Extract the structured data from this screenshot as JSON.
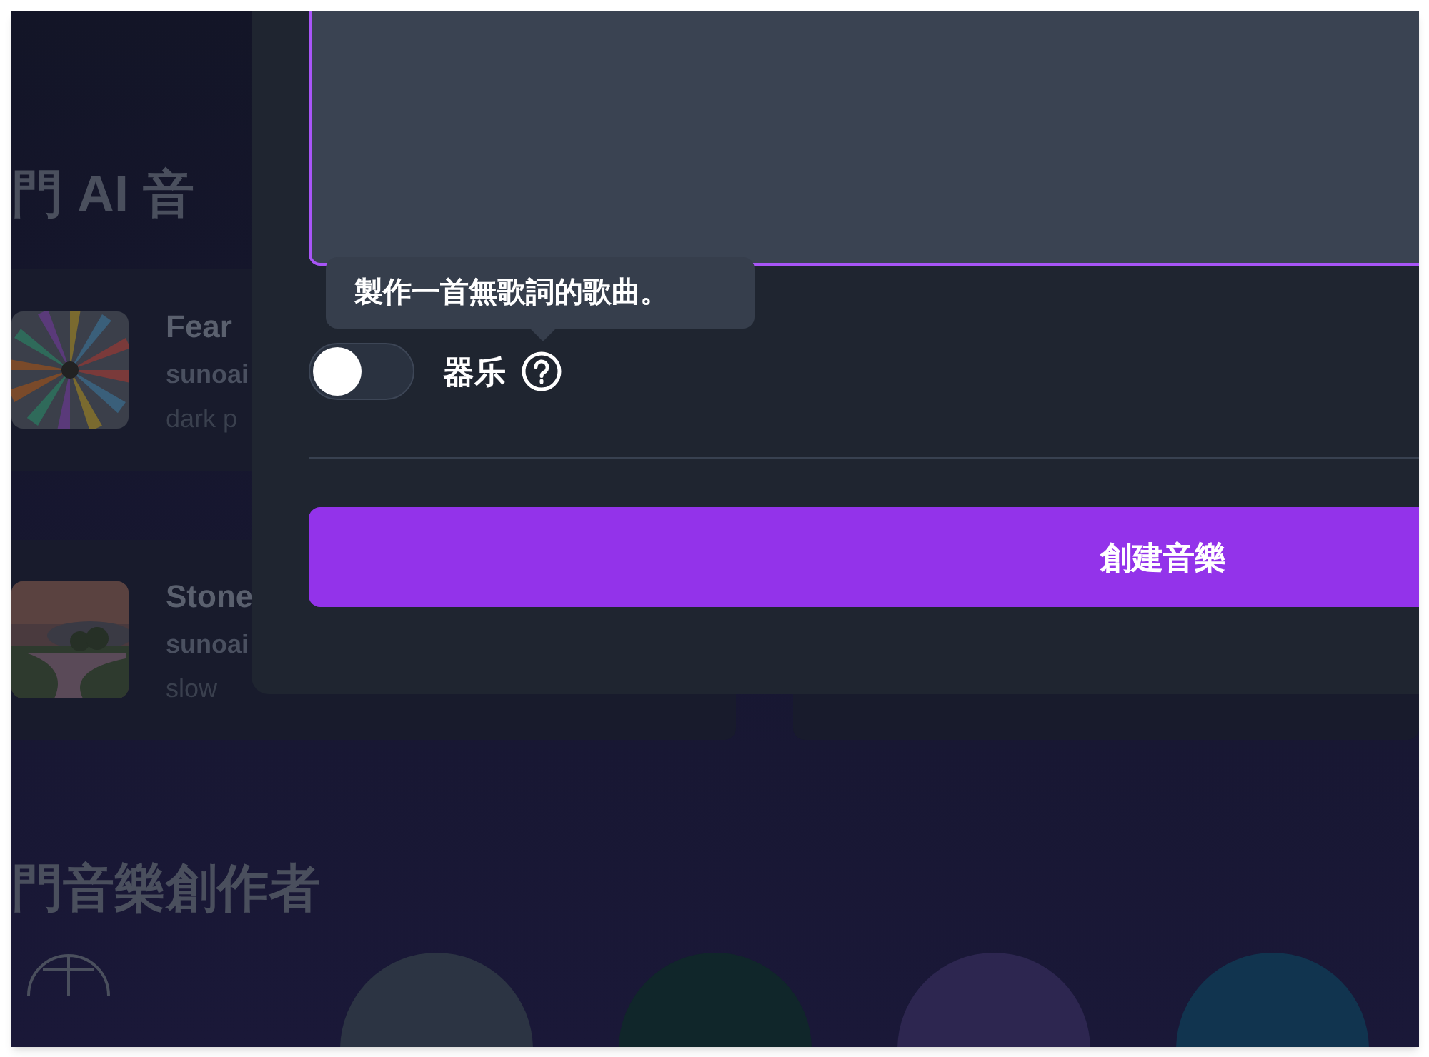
{
  "background": {
    "songs_heading": "門 AI 音",
    "songs": [
      {
        "title": "Fear",
        "artist": "sunoai",
        "tags": "dark p"
      },
      {
        "title": "Stone",
        "artist": "sunoai",
        "tags": "slow"
      }
    ],
    "creators_heading": "門音樂創作者",
    "creator_avatars": [
      {
        "color": "#2c3443"
      },
      {
        "color": "#10262a"
      },
      {
        "color": "#2d2650"
      },
      {
        "color": "#11344f"
      }
    ]
  },
  "dialog": {
    "lyrics_field": {
      "focused": true
    },
    "tooltip": "製作一首無歌詞的歌曲。",
    "instrumental_toggle": {
      "label": "器乐",
      "on": false
    },
    "create_button": "創建音樂"
  }
}
